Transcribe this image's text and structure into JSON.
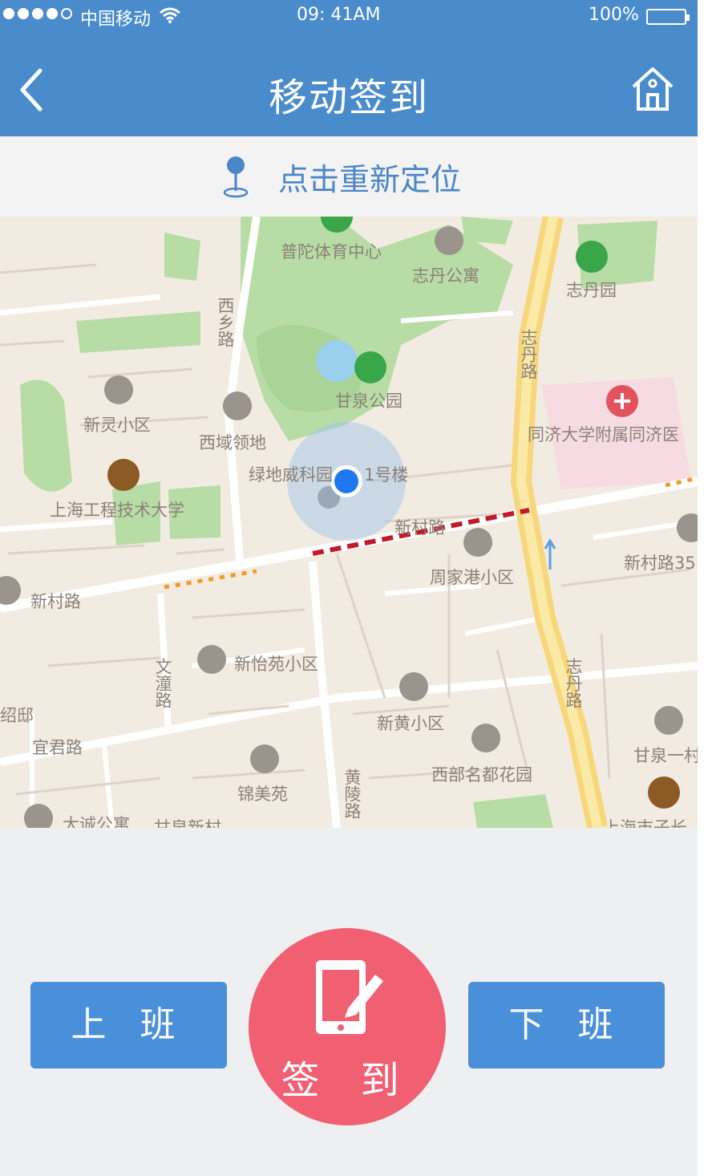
{
  "status_bar": {
    "carrier": "中国移动",
    "time": "09: 41AM",
    "battery": "100%"
  },
  "nav": {
    "title": "移动签到",
    "back_icon": "chevron-left-icon",
    "home_icon": "home-icon"
  },
  "relocate": {
    "icon": "location-pin-icon",
    "label": "点击重新定位"
  },
  "map": {
    "labels": {
      "putuo_sports": "普陀体育中心",
      "zhidan_apartment": "志丹公寓",
      "zhidan_garden": "志丹园",
      "xixiang_road": "西乡路",
      "ganquan_park": "甘泉公园",
      "xinling": "新灵小区",
      "xiyu": "西域领地",
      "lvdi": "绿地威科园",
      "building": "1号楼",
      "tongji": "同济大学附属同济医",
      "sues": "上海工程技术大学",
      "xincun_road_center": "新村路",
      "xincun_road_left": "新村路",
      "xincun_road_right": "新村路35",
      "zhoujiagang": "周家港小区",
      "zhidan_road_upper": "志丹路",
      "zhidan_road_lower": "志丹路",
      "xinyiyuan": "新怡苑小区",
      "wenjun_road": "文潼路",
      "shao": "绍邸",
      "xinhuang": "新黄小区",
      "yijun_road": "宜君路",
      "jinmei": "锦美苑",
      "huangling_road": "黄陵路",
      "xibu_mingdu": "西部名都花园",
      "ganquan_one": "甘泉一村",
      "dacheng": "大诚公寓",
      "ganquan_xincun": "甘泉新村",
      "shanghai_kids": "上海市子长"
    }
  },
  "actions": {
    "on_duty": "上 班",
    "off_duty": "下 班",
    "check_in": "签 到",
    "check_in_icon": "phone-sign-icon"
  },
  "colors": {
    "primary": "#4a8bcc",
    "button": "#4a8fd9",
    "check_in": "#f06072",
    "location_dot": "#1f78f0"
  }
}
